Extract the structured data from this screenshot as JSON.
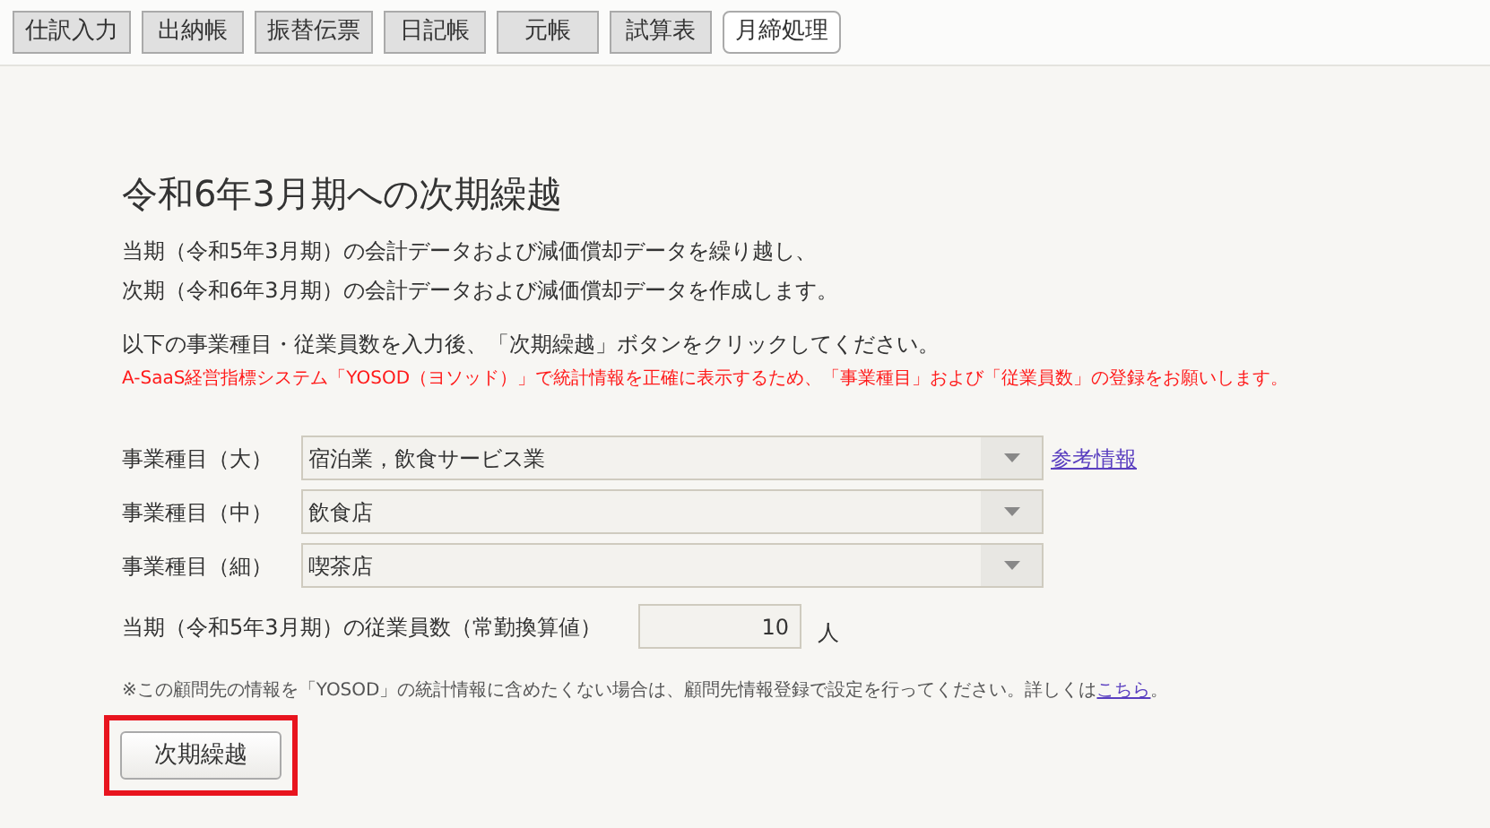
{
  "tabs": [
    {
      "label": "仕訳入力",
      "selected": false
    },
    {
      "label": "出納帳",
      "selected": false
    },
    {
      "label": "振替伝票",
      "selected": false
    },
    {
      "label": "日記帳",
      "selected": false
    },
    {
      "label": "元帳",
      "selected": false
    },
    {
      "label": "試算表",
      "selected": false
    },
    {
      "label": "月締処理",
      "selected": true
    }
  ],
  "heading": "令和6年3月期への次期繰越",
  "description": [
    "当期（令和5年3月期）の会計データおよび減価償却データを繰り越し、",
    "次期（令和6年3月期）の会計データおよび減価償却データを作成します。"
  ],
  "instruction": "以下の事業種目・従業員数を入力後、「次期繰越」ボタンをクリックしてください。",
  "notice": "A-SaaS経営指標システム「YOSOD（ヨソッド）」で統計情報を正確に表示するため、「事業種目」および「従業員数」の登録をお願いします。",
  "form": {
    "selects": [
      {
        "label": "事業種目（大）",
        "value": "宿泊業，飲食サービス業",
        "link": "参考情報"
      },
      {
        "label": "事業種目（中）",
        "value": "飲食店"
      },
      {
        "label": "事業種目（細）",
        "value": "喫茶店"
      }
    ],
    "employees": {
      "label": "当期（令和5年3月期）の従業員数（常勤換算値）",
      "value": "10",
      "unit": "人"
    }
  },
  "footnote": {
    "text": "※この顧問先の情報を「YOSOD」の統計情報に含めたくない場合は、顧問先情報登録で設定を行ってください。詳しくは",
    "link": "こちら",
    "end": "。"
  },
  "submit": {
    "label": "次期繰越",
    "highlighted": true
  }
}
